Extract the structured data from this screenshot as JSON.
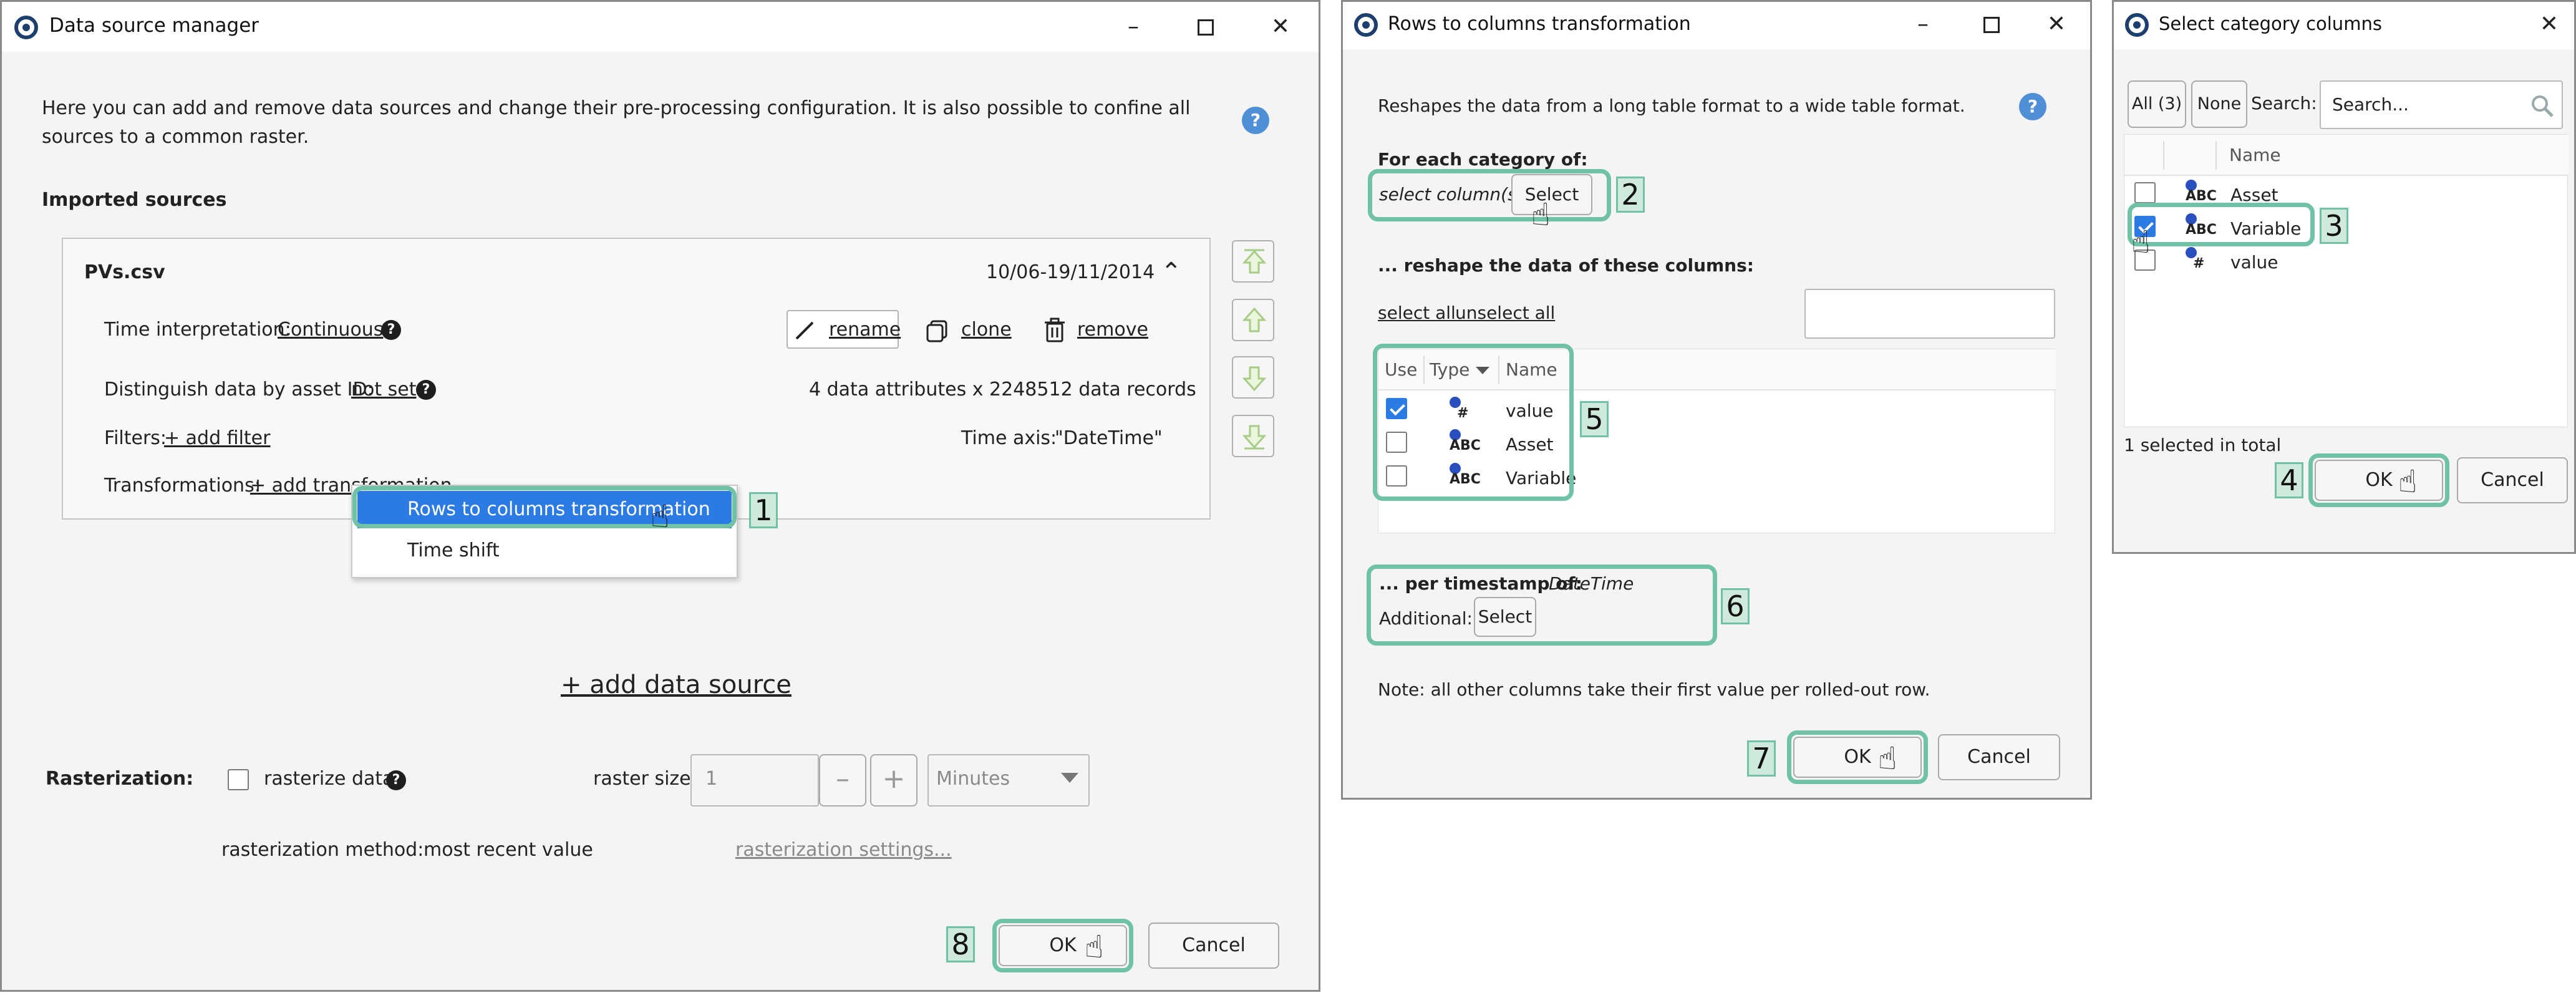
{
  "ds": {
    "title": "Data source manager",
    "description": "Here you can add and remove data sources and change their pre-processing configuration. It is also possible to confine all sources to a common raster.",
    "imported_sources_label": "Imported sources",
    "source": {
      "name": "PVs.csv",
      "date_range": "10/06-19/11/2014",
      "time_interp_label": "Time interpretation:",
      "time_interp_value": "Continuous",
      "rename": "rename",
      "clone": "clone",
      "remove": "remove",
      "distinguish_label": "Distinguish data by asset ID:",
      "distinguish_value": "not set",
      "records_info": "4 data attributes x 2248512 data records",
      "filters_label": "Filters:",
      "add_filter": "+ add filter",
      "time_axis_label": "Time axis:",
      "time_axis_value": "\"DateTime\"",
      "transformations_label": "Transformations:",
      "add_transformation": "+ add transformation"
    },
    "menu": [
      "Rows to columns transformation",
      "Time shift"
    ],
    "add_data_source": "+ add data source",
    "rasterization_label": "Rasterization:",
    "rasterize_data": "rasterize data",
    "raster_size_label": "raster size:",
    "raster_size_value": "1",
    "raster_unit": "Minutes",
    "rasterization_method_label": "rasterization method:",
    "rasterization_method_value": "most recent value",
    "rasterization_settings": "rasterization settings...",
    "ok": "OK",
    "cancel": "Cancel"
  },
  "rtc": {
    "title": "Rows to columns transformation",
    "description": "Reshapes the data from a long table format to a wide table format.",
    "for_each_label": "For each category of:",
    "select_columns_placeholder": "select column(s)",
    "select": "Select",
    "reshape_label": "... reshape the data of these columns:",
    "select_all": "select all",
    "unselect_all": "unselect all",
    "col_use": "Use",
    "col_type": "Type",
    "col_name": "Name",
    "rows": [
      {
        "name": "value",
        "type": "#",
        "checked": true
      },
      {
        "name": "Asset",
        "type": "ABC",
        "checked": false
      },
      {
        "name": "Variable",
        "type": "ABC",
        "checked": false
      }
    ],
    "per_timestamp_label": "... per timestamp of:",
    "per_timestamp_value": "DateTime",
    "additional_label": "Additional:",
    "note": "Note: all other columns take their first value per rolled-out row.",
    "ok": "OK",
    "cancel": "Cancel"
  },
  "scc": {
    "title": "Select category columns",
    "all": "All (3)",
    "none": "None",
    "search_label": "Search:",
    "search_placeholder": "Search...",
    "col_name": "Name",
    "rows": [
      {
        "name": "Asset",
        "type": "ABC",
        "checked": false
      },
      {
        "name": "Variable",
        "type": "ABC",
        "checked": true
      },
      {
        "name": "value",
        "type": "#",
        "checked": false
      }
    ],
    "selected_total": "1 selected in total",
    "ok": "OK",
    "cancel": "Cancel"
  },
  "steps": [
    "1",
    "2",
    "3",
    "4",
    "5",
    "6",
    "7",
    "8"
  ],
  "colors": {
    "highlight": "#6fc2a3",
    "selection": "#2c7be5",
    "help": "#4e8fd6"
  }
}
